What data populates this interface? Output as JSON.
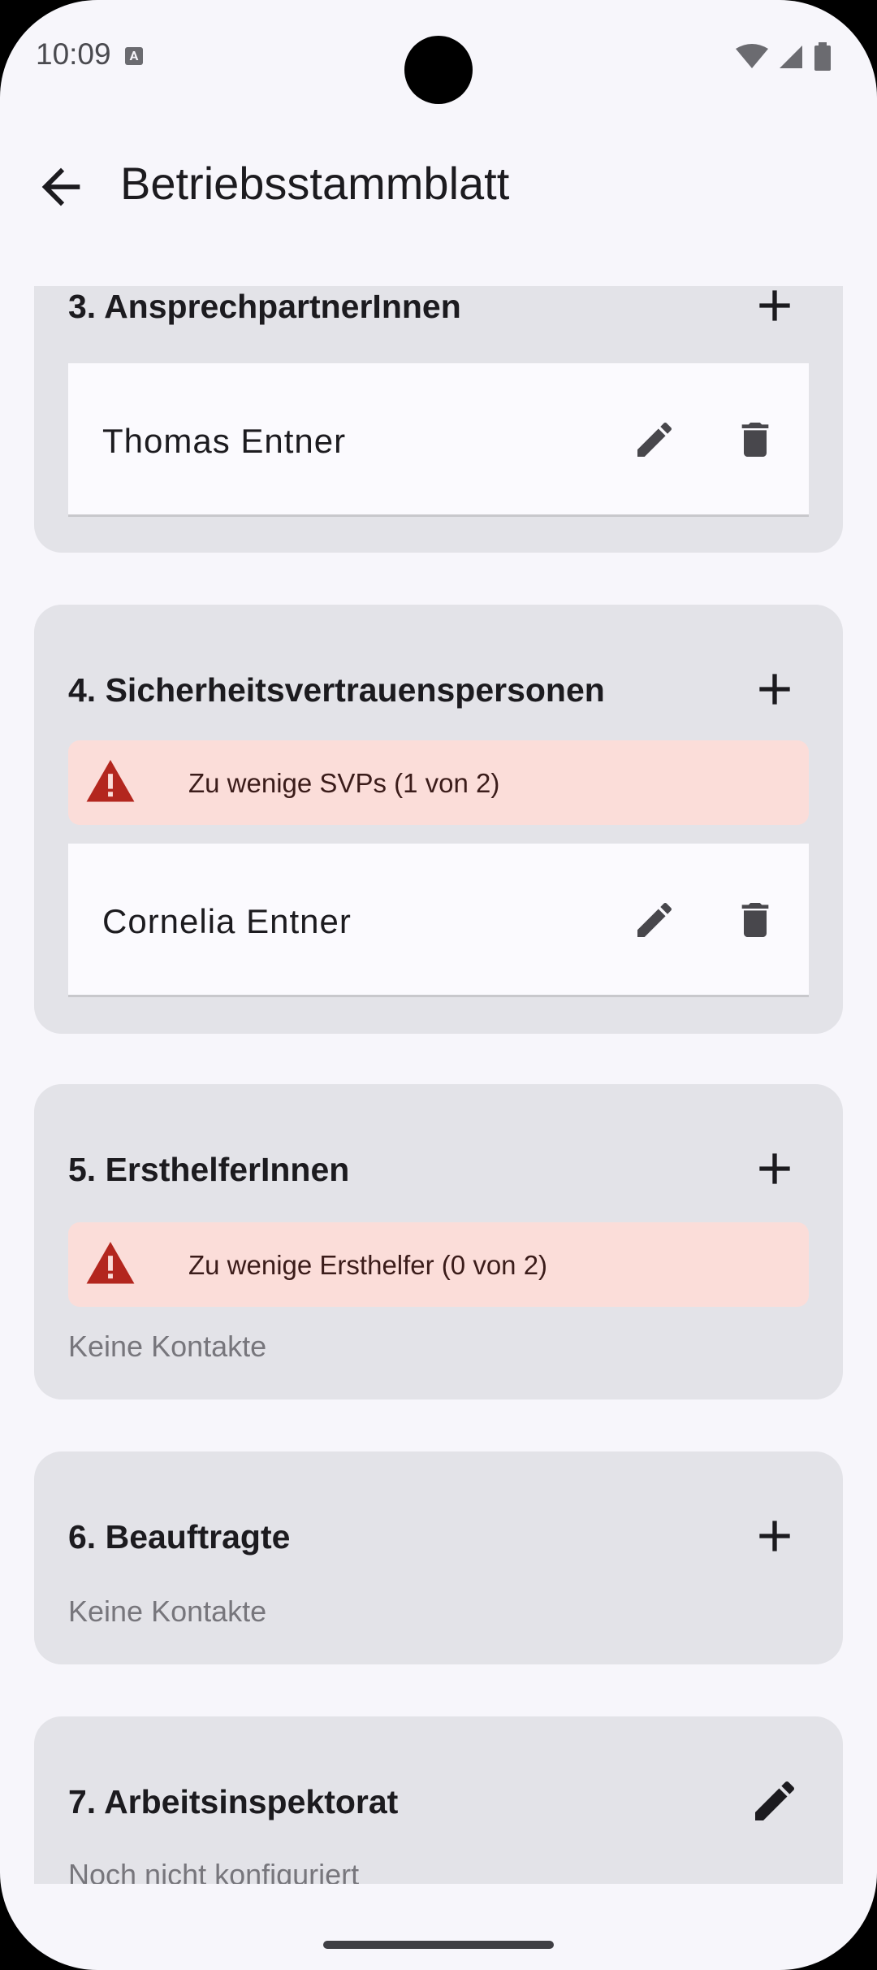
{
  "status_bar": {
    "time": "10:09",
    "notif_letter": "A"
  },
  "app_bar": {
    "title": "Betriebsstammblatt"
  },
  "sections": {
    "s3": {
      "title": "3. AnsprechpartnerInnen",
      "contacts": [
        "Thomas Entner"
      ]
    },
    "s4": {
      "title": "4. Sicherheitsvertrauenspersonen",
      "warning": "Zu wenige SVPs (1 von 2)",
      "contacts": [
        "Cornelia Entner"
      ]
    },
    "s5": {
      "title": "5. ErsthelferInnen",
      "warning": "Zu wenige Ersthelfer (0 von 2)",
      "empty": "Keine Kontakte"
    },
    "s6": {
      "title": "6. Beauftragte",
      "empty": "Keine Kontakte"
    },
    "s7": {
      "title": "7. Arbeitsinspektorat",
      "empty": "Noch nicht konfiguriert"
    }
  },
  "icons": {
    "back": "arrow-back-icon",
    "add": "plus-icon",
    "edit": "pencil-icon",
    "delete": "trash-icon",
    "warning": "warning-triangle-icon"
  },
  "colors": {
    "background": "#f7f6fb",
    "card": "#e3e3e8",
    "contact_row": "#fbfafe",
    "warning_bg": "#fbddd9",
    "warning_icon": "#b3261e",
    "text": "#1c1b1f",
    "muted": "#77767c"
  }
}
